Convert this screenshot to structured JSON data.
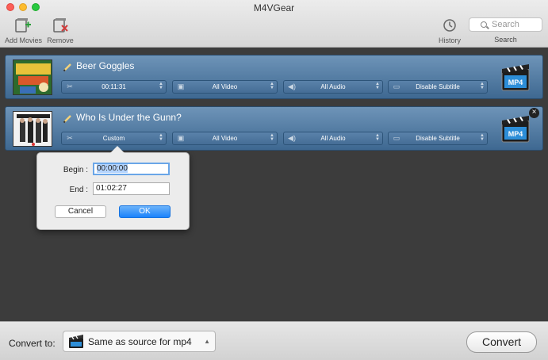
{
  "window": {
    "title": "M4VGear"
  },
  "toolbar": {
    "add_movies_label": "Add Movies",
    "remove_label": "Remove",
    "history_label": "History",
    "search_placeholder": "Search",
    "search_label": "Search"
  },
  "movies": [
    {
      "title": "Beer Goggles",
      "trim": "00:11:31",
      "video": "All Video",
      "audio": "All Audio",
      "subtitle": "Disable Subtitle",
      "format_badge": "MP4"
    },
    {
      "title": "Who Is Under the Gunn?",
      "trim": "Custom",
      "video": "All Video",
      "audio": "All Audio",
      "subtitle": "Disable Subtitle",
      "format_badge": "MP4"
    }
  ],
  "trim_popover": {
    "begin_label": "Begin :",
    "begin_value": "00:00:00",
    "end_label": "End :",
    "end_value": "01:02:27",
    "cancel_label": "Cancel",
    "ok_label": "OK"
  },
  "bottom": {
    "convert_to_label": "Convert to:",
    "format_value": "Same as source for mp4",
    "convert_label": "Convert"
  },
  "colors": {
    "row_blue": "#4a73a0",
    "ok_blue": "#1a82fb",
    "content_bg": "#3c3c3c"
  }
}
